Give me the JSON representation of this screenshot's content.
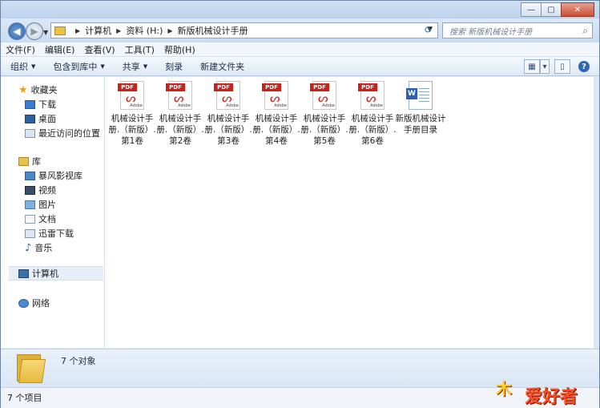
{
  "window": {
    "buttons": {
      "minimize": "—",
      "maximize": "▢",
      "close": "✕"
    }
  },
  "nav": {
    "breadcrumb": [
      "计算机",
      "资料 (H:)",
      "新版机械设计手册"
    ],
    "search_placeholder": "搜索 新版机械设计手册"
  },
  "menubar": [
    "文件(F)",
    "编辑(E)",
    "查看(V)",
    "工具(T)",
    "帮助(H)"
  ],
  "toolbar": {
    "organize": "组织",
    "include_library": "包含到库中",
    "share": "共享",
    "burn": "刻录",
    "new_folder": "新建文件夹"
  },
  "sidebar": {
    "favorites": "收藏夹",
    "favorites_items": [
      "下载",
      "桌面",
      "最近访问的位置"
    ],
    "library": "库",
    "library_items": [
      "暴风影视库",
      "视频",
      "图片",
      "文档",
      "迅雷下载",
      "音乐"
    ],
    "computer": "计算机",
    "network": "网络"
  },
  "files": [
    {
      "type": "pdf",
      "name": "机械设计手册.（新版）.第1卷"
    },
    {
      "type": "pdf",
      "name": "机械设计手册.（新版）.第2卷"
    },
    {
      "type": "pdf",
      "name": "机械设计手册.（新版）.第3卷"
    },
    {
      "type": "pdf",
      "name": "机械设计手册.（新版）.第4卷"
    },
    {
      "type": "pdf",
      "name": "机械设计手册.（新版）.第5卷"
    },
    {
      "type": "pdf",
      "name": "机械设计手册.（新版）.第6卷"
    },
    {
      "type": "word",
      "name": "新版机械设计手册目录"
    }
  ],
  "icon_labels": {
    "pdf": "PDF",
    "adobe": "Adobe",
    "word": "W"
  },
  "details": {
    "count": "7 个对象"
  },
  "status": {
    "text": "7 个项目"
  },
  "watermark": {
    "text": "爱好者"
  },
  "colors": {
    "pdf_red": "#c8221d",
    "word_blue": "#2b5fb5",
    "folder_yellow": "#e6b83d"
  }
}
